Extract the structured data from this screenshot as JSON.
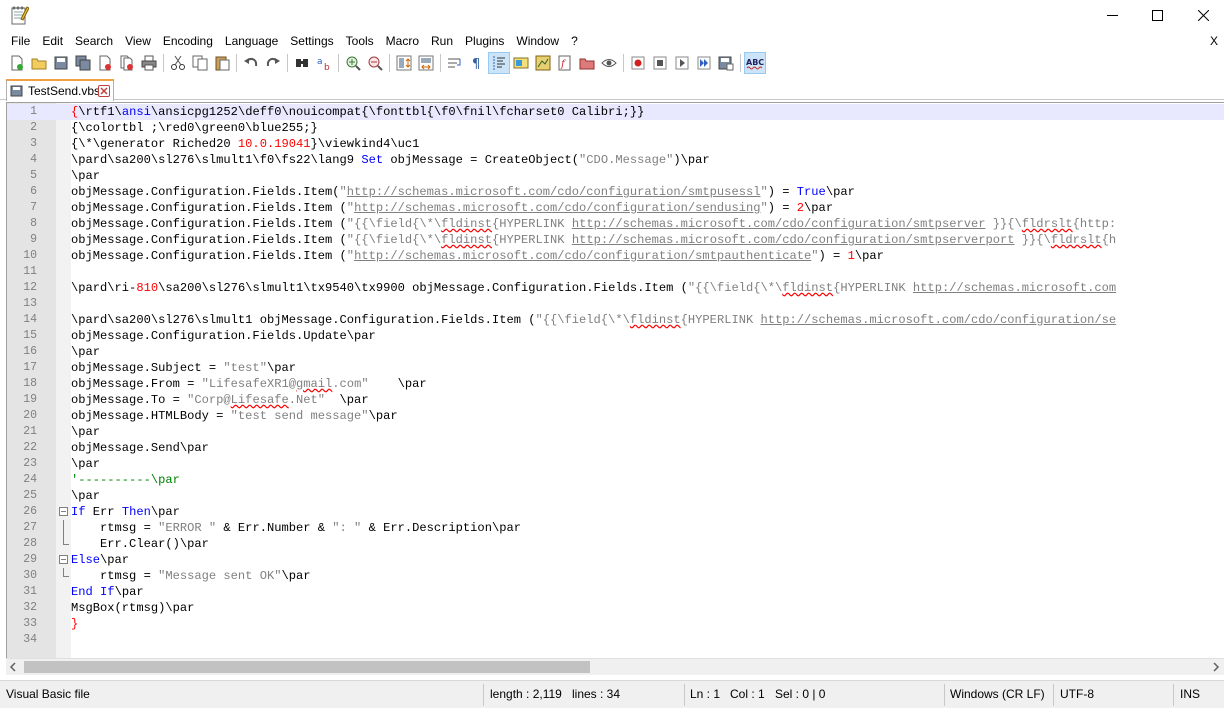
{
  "window": {
    "minimize_label": "minimize",
    "maximize_label": "maximize",
    "close_label": "close"
  },
  "menu": [
    "File",
    "Edit",
    "Search",
    "View",
    "Encoding",
    "Language",
    "Settings",
    "Tools",
    "Macro",
    "Run",
    "Plugins",
    "Window",
    "?"
  ],
  "menu_close": "X",
  "toolbar_icons": [
    "new-file-icon",
    "open-file-icon",
    "save-icon",
    "save-all-icon",
    "close-icon",
    "close-all-icon",
    "print-icon",
    "cut-icon",
    "copy-icon",
    "paste-icon",
    "undo-icon",
    "redo-icon",
    "find-icon",
    "replace-icon",
    "zoom-in-icon",
    "zoom-out-icon",
    "sync-vertical-icon",
    "sync-horizontal-icon",
    "word-wrap-icon",
    "show-all-chars-icon",
    "indent-guide-icon",
    "user-lang-icon",
    "doc-map-icon",
    "function-list-icon",
    "folder-workspace-icon",
    "monitoring-icon",
    "record-macro-icon",
    "stop-macro-icon",
    "play-macro-icon",
    "run-macro-multiple-icon",
    "save-macro-icon",
    "spell-check-icon"
  ],
  "tab": {
    "label": "TestSend.vbs"
  },
  "editor": {
    "line_numbers": [
      "1",
      "2",
      "3",
      "4",
      "5",
      "6",
      "7",
      "8",
      "9",
      "10",
      "11",
      "12",
      "13",
      "14",
      "15",
      "16",
      "17",
      "18",
      "19",
      "20",
      "21",
      "22",
      "23",
      "24",
      "25",
      "26",
      "27",
      "28",
      "29",
      "30",
      "31",
      "32",
      "33",
      "34"
    ]
  },
  "status": {
    "file_type": "Visual Basic file",
    "length": "length : 2,119",
    "lines": "lines : 34",
    "ln": "Ln : 1",
    "col": "Col : 1",
    "sel": "Sel : 0 | 0",
    "eol": "Windows (CR LF)",
    "encoding": "UTF-8",
    "mode": "INS"
  },
  "colors": {
    "keyword": "#0000ff",
    "string": "#808080",
    "number": "#ff0000",
    "comment": "#008000",
    "current_line": "#e8e8ff"
  }
}
